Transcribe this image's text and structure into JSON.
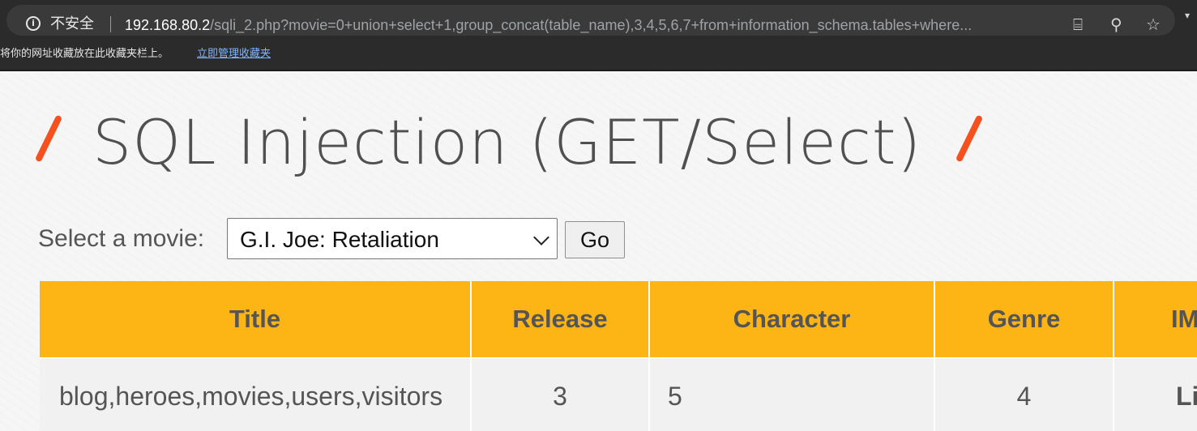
{
  "browser": {
    "security_label": "不安全",
    "url_host": "192.168.80.2",
    "url_path": "/sqli_2.php?movie=0+union+select+1,group_concat(table_name),3,4,5,6,7+from+information_schema.tables+where...",
    "icons": [
      "info-icon",
      "translate-icon",
      "zoom-icon",
      "star-icon",
      "menu-icon"
    ]
  },
  "bookmarks_bar": {
    "message": "将你的网址收藏放在此收藏夹栏上。",
    "link": "立即管理收藏夹"
  },
  "page": {
    "title": "SQL Injection (GET/Select)",
    "accent_color": "#f4511e",
    "select_label": "Select a movie:",
    "selected_movie": "G.I. Joe: Retaliation",
    "go_button": "Go"
  },
  "table": {
    "header_color": "#fdb515",
    "columns": [
      "Title",
      "Release",
      "Character",
      "Genre",
      "IMDb"
    ],
    "rows": [
      [
        "blog,heroes,movies,users,visitors",
        "3",
        "5",
        "4",
        "Link"
      ]
    ]
  }
}
